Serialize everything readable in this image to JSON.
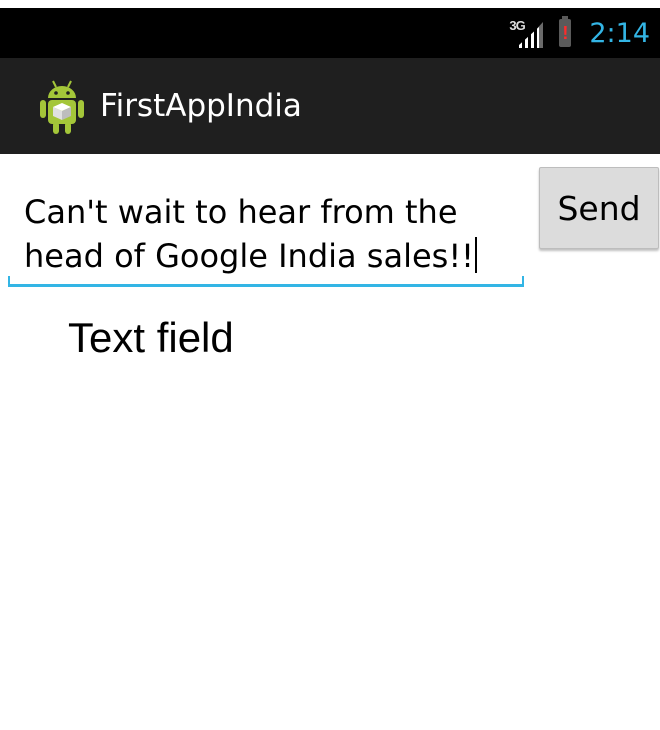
{
  "status_bar": {
    "network_type": "3G",
    "time": "2:14",
    "battery_alert": "!"
  },
  "action_bar": {
    "app_icon": "android-robot-icon",
    "title": "FirstAppIndia"
  },
  "message_field": {
    "value": "Can't wait to hear from the head of Google India sales!!"
  },
  "send_button": {
    "label": "Send"
  },
  "annotation": {
    "text": "Text field"
  },
  "colors": {
    "accent": "#33b5e5",
    "action_bar_bg": "#1f1f1f",
    "status_bar_bg": "#000000",
    "button_bg": "#dcdcdc",
    "android_green": "#a4c639"
  }
}
